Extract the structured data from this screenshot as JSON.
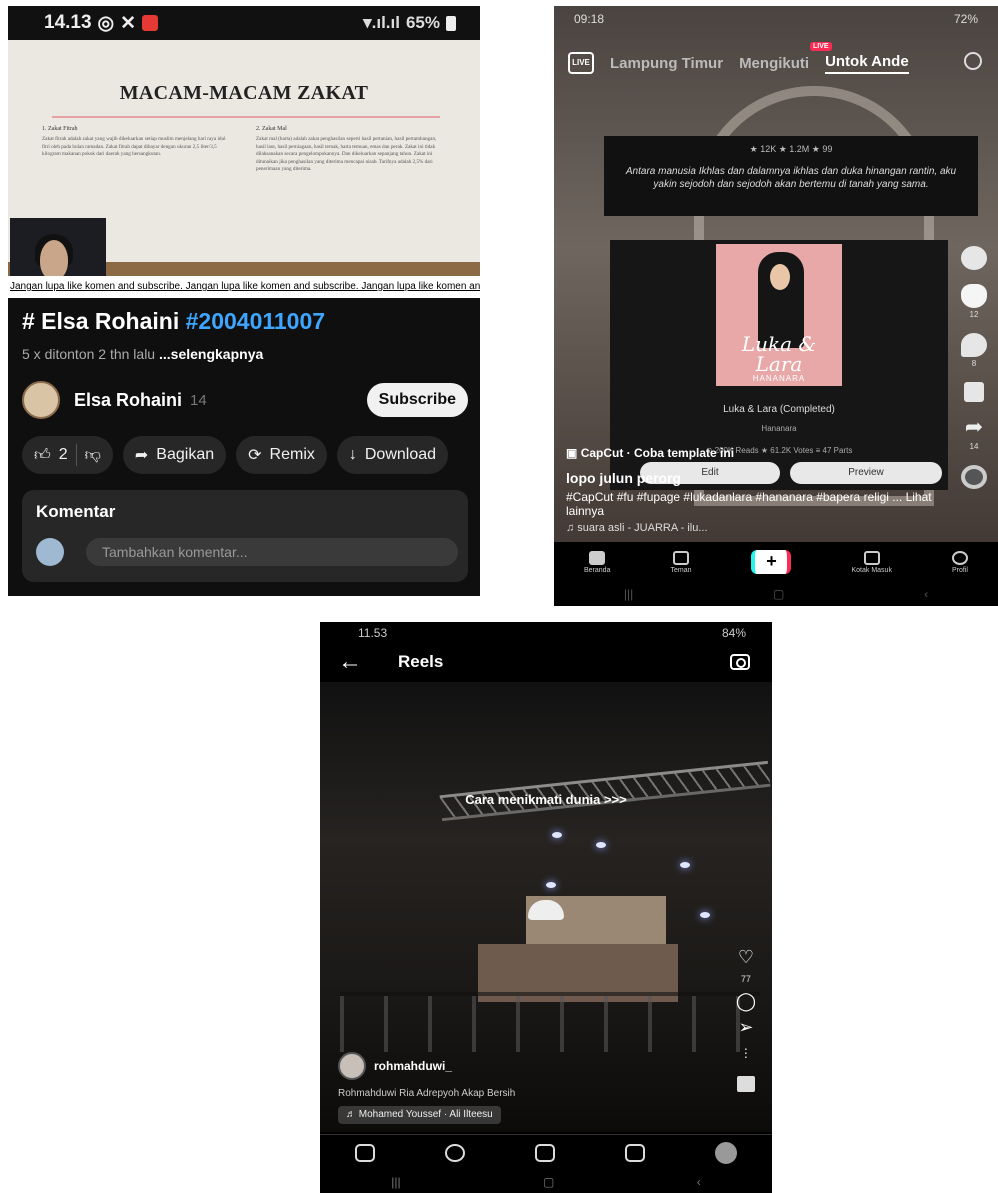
{
  "youtube": {
    "status": {
      "time": "14.13",
      "battery": "65%"
    },
    "video": {
      "doc_title": "MACAM-MACAM ZAKAT",
      "doc_col1_heading": "1. Zakat Fitrah",
      "doc_col1_body": "Zakat fitrah adalah zakat yang wajib dikeluarkan setiap muslim menjelang hari raya idul fitri oleh pada bulan ramadan. Zakat fitrah dapat dibayar dengan ukuran 2,5 liter/3,5 kilogram makanan pokok dari daerah yang bersangkutan.",
      "doc_col2_heading": "2. Zakat Mal",
      "doc_col2_body": "Zakat mal (harta) adalah zakat penghasilan seperti hasil pertanian, hasil pertambangan, hasil laut, hasil perniagaan, hasil ternak, harta temuan, emas dan perak. Zakat ini tidak dilaksanakan secara pengelompokannya. Dan dikeluarkan sepanjang tahun. Zakat ini ditunaikan jika penghasilan yang diterima mencapai nisab. Tarifnya adalah 2,5% dari penerimaan yang diterima.",
      "marquee": "Jangan lupa like komen and subscribe. Jangan lupa like komen and subscribe. Jangan lupa like komen and subscribe. Jangan l"
    },
    "title": "# Elsa Rohaini",
    "title_tag": "#2004011007",
    "meta": "5 x ditonton  2 thn lalu",
    "meta_more": "...selengkapnya",
    "channel_name": "Elsa Rohaini",
    "channel_subs": "14",
    "subscribe_label": "Subscribe",
    "like_count": "2",
    "share_label": "Bagikan",
    "remix_label": "Remix",
    "download_label": "Download",
    "comments_heading": "Komentar",
    "comment_placeholder": "Tambahkan komentar..."
  },
  "tiktok": {
    "status": {
      "time": "09:18",
      "battery": "72%"
    },
    "tabs": [
      "Lampung Timur",
      "Mengikuti",
      "Untok Ande"
    ],
    "live_label": "LIVE",
    "quote_stats": "★ 12K   ★ 1.2M   ★ 99",
    "quote_text": "Antara manusia Ikhlas dan dalamnya ikhlas dan duka hinangan rantin, aku yakin sejodoh dan sejodoh akan bertemu di tanah yang sama.",
    "book_title_cover": "Luka & Lara",
    "book_author_cover": "HANANARA",
    "book_name": "Luka & Lara (Completed)",
    "book_author": "Hananara",
    "book_stats": "⊙ 200K Reads  ★ 61.2K Votes  ≡ 47 Parts",
    "edit_label": "Edit",
    "preview_label": "Preview",
    "capcut_label": "CapCut · Coba template ini",
    "username": "lopo julun perorg",
    "caption": "#CapCut #fu #fupage #lukadanlara #hananara #bapera religi ... Lihat lainnya",
    "sound": "♫ suara asli - JUARRA - ilu...",
    "rail_counts": [
      "12",
      "8",
      "14"
    ],
    "nav": [
      "Beranda",
      "Teman",
      "",
      "Kotak Masuk",
      "Profil"
    ]
  },
  "instagram": {
    "status": {
      "time": "11.53",
      "battery": "84%"
    },
    "header_title": "Reels",
    "overlay_text": "Cara menikmati dunia >>>",
    "like_count": "77",
    "username": "rohmahduwi_",
    "description": "Rohmahduwi  Ria  Adrepyoh  Akap  Bersih",
    "audio": "♬ Mohamed Youssef · Ali Ilteesu"
  }
}
